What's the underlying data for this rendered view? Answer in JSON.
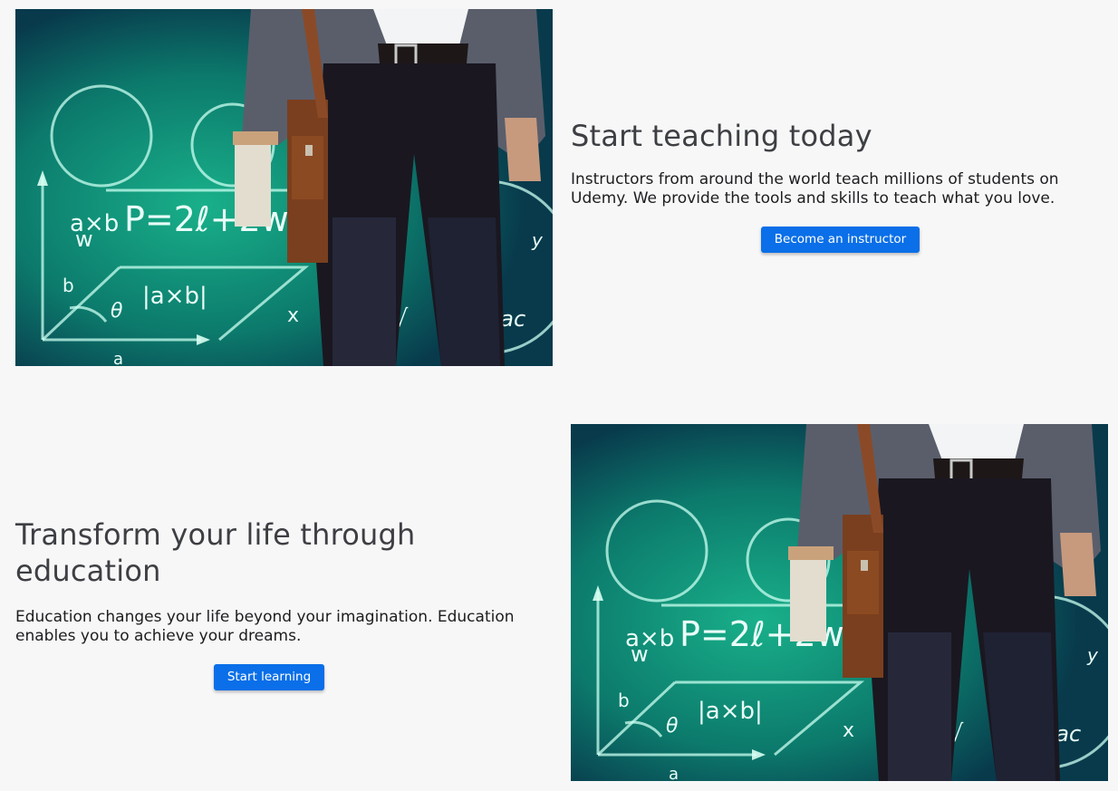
{
  "teach_section": {
    "heading": "Start teaching today",
    "body": "Instructors from around the world teach millions of students on Udemy. We provide the tools and skills to teach what you love.",
    "button_label": "Become an instructor"
  },
  "learn_section": {
    "heading": "Transform your life through education",
    "body": "Education changes your life beyond your imagination. Education enables you to achieve your dreams.",
    "button_label": "Start learning"
  },
  "image": {
    "chalk_formula": "P=2ℓ+2w",
    "chalk_labels": [
      "a×b",
      "|a×b|",
      "θ",
      "±√",
      "4ac",
      "a",
      "b",
      "w",
      "x",
      "y"
    ]
  },
  "colors": {
    "background": "#f7f7f8",
    "button": "#0a6fe8",
    "heading": "#3d3f43"
  }
}
